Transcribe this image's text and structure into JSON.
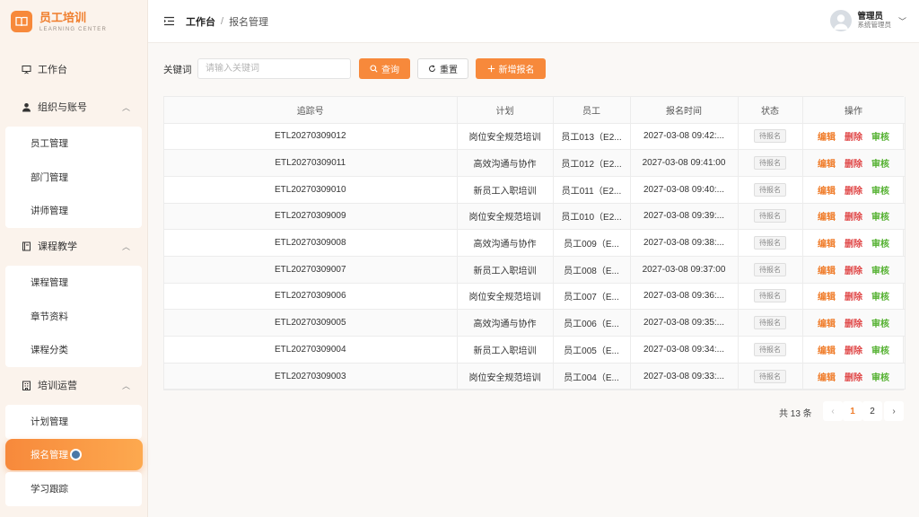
{
  "brand": {
    "title": "员工培训",
    "subtitle": "LEARNING CENTER"
  },
  "sidebar": {
    "workbench": "工作台",
    "groups": [
      {
        "label": "组织与账号",
        "items": [
          "员工管理",
          "部门管理",
          "讲师管理"
        ]
      },
      {
        "label": "课程教学",
        "items": [
          "课程管理",
          "章节资料",
          "课程分类"
        ]
      },
      {
        "label": "培训运营",
        "items": [
          "计划管理",
          "报名管理",
          "学习跟踪"
        ]
      }
    ]
  },
  "header": {
    "home": "工作台",
    "separator": "/",
    "current": "报名管理"
  },
  "user": {
    "name": "管理员",
    "role": "系统管理员"
  },
  "filter": {
    "label": "关键词",
    "placeholder": "请输入关键词",
    "query_label": "查询",
    "reset_label": "重置",
    "add_label": "新增报名"
  },
  "table": {
    "columns": [
      "追踪号",
      "计划",
      "员工",
      "报名时间",
      "状态",
      "操作"
    ],
    "rows": [
      {
        "id": "ETL20270309012",
        "plan": "岗位安全规范培训",
        "employee": "员工013（E2...",
        "time": "2027-03-08 09:42:...",
        "status": "待报名"
      },
      {
        "id": "ETL20270309011",
        "plan": "高效沟通与协作",
        "employee": "员工012（E2...",
        "time": "2027-03-08 09:41:00",
        "status": "待报名"
      },
      {
        "id": "ETL20270309010",
        "plan": "新员工入职培训",
        "employee": "员工011（E2...",
        "time": "2027-03-08 09:40:...",
        "status": "待报名"
      },
      {
        "id": "ETL20270309009",
        "plan": "岗位安全规范培训",
        "employee": "员工010（E2...",
        "time": "2027-03-08 09:39:...",
        "status": "待报名"
      },
      {
        "id": "ETL20270309008",
        "plan": "高效沟通与协作",
        "employee": "员工009（E...",
        "time": "2027-03-08 09:38:...",
        "status": "待报名"
      },
      {
        "id": "ETL20270309007",
        "plan": "新员工入职培训",
        "employee": "员工008（E...",
        "time": "2027-03-08 09:37:00",
        "status": "待报名"
      },
      {
        "id": "ETL20270309006",
        "plan": "岗位安全规范培训",
        "employee": "员工007（E...",
        "time": "2027-03-08 09:36:...",
        "status": "待报名"
      },
      {
        "id": "ETL20270309005",
        "plan": "高效沟通与协作",
        "employee": "员工006（E...",
        "time": "2027-03-08 09:35:...",
        "status": "待报名"
      },
      {
        "id": "ETL20270309004",
        "plan": "新员工入职培训",
        "employee": "员工005（E...",
        "time": "2027-03-08 09:34:...",
        "status": "待报名"
      },
      {
        "id": "ETL20270309003",
        "plan": "岗位安全规范培训",
        "employee": "员工004（E...",
        "time": "2027-03-08 09:33:...",
        "status": "待报名"
      }
    ],
    "actions": {
      "edit": "编辑",
      "delete": "删除",
      "audit": "审核"
    }
  },
  "pagination": {
    "total": "共 13 条",
    "pages": [
      "1",
      "2"
    ],
    "current": "1"
  },
  "icons": {
    "brand": "book-icon",
    "workbench": "presentation-icon",
    "org": "user-icon",
    "course": "book-icon",
    "ops": "building-icon",
    "menu": "menu-fold-icon",
    "search": "search-icon",
    "reset": "refresh-icon",
    "add": "plus-icon"
  },
  "colors": {
    "accent": "#f7893b",
    "delete": "#e04848",
    "audit": "#52b02e"
  }
}
